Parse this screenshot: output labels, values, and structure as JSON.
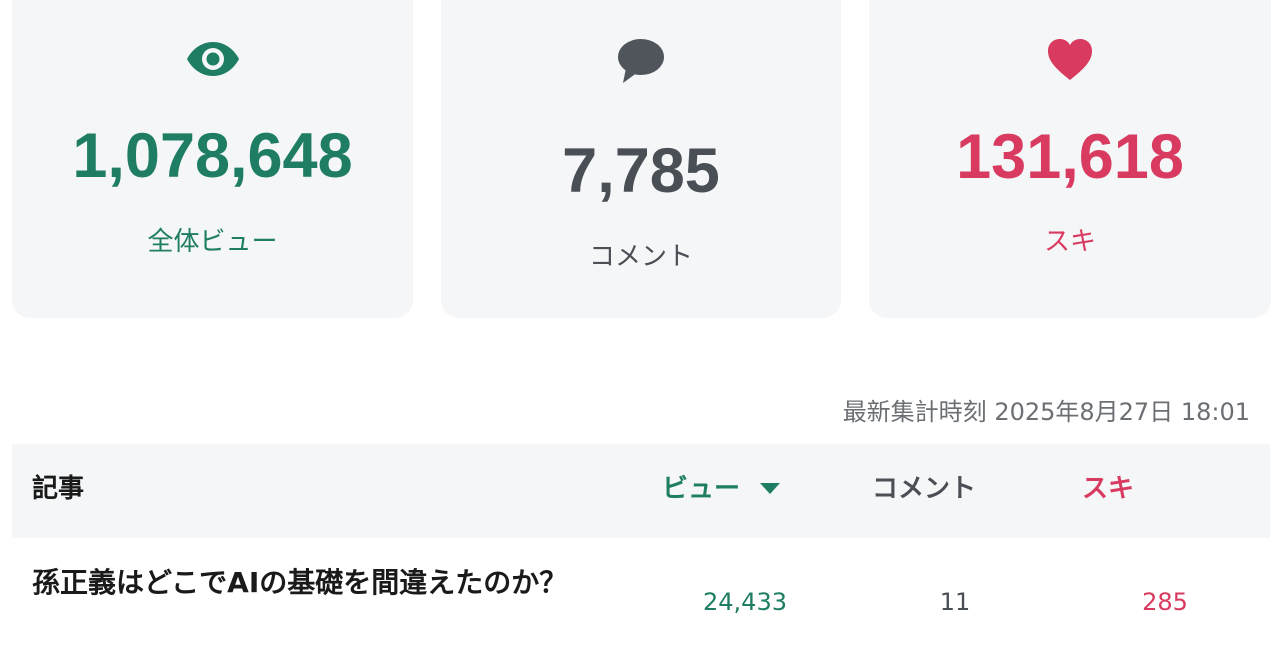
{
  "colors": {
    "views": "#1e7d62",
    "comments": "#4a4f55",
    "likes": "#d93a5f",
    "muted": "#6b6f73"
  },
  "summary": {
    "views": {
      "icon": "eye-icon",
      "value": "1,078,648",
      "label": "全体ビュー"
    },
    "comments": {
      "icon": "speech-bubble-icon",
      "value": "7,785",
      "label": "コメント"
    },
    "likes": {
      "icon": "heart-icon",
      "value": "131,618",
      "label": "スキ"
    }
  },
  "updated_at": "最新集計時刻 2025年8月27日 18:01",
  "table": {
    "headers": {
      "article": "記事",
      "views": "ビュー",
      "comments": "コメント",
      "likes": "スキ"
    },
    "sort": {
      "column": "views",
      "direction": "descending"
    },
    "rows": [
      {
        "title": "孫正義はどこでAIの基礎を間違えたのか？",
        "views": "24,433",
        "comments": "11",
        "likes": "285"
      }
    ]
  }
}
